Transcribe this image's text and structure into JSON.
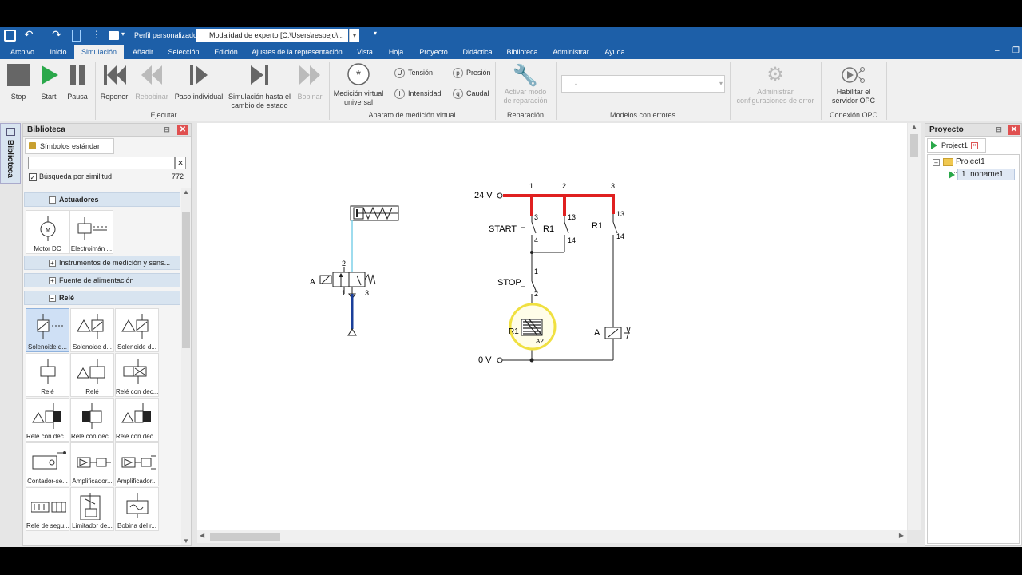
{
  "quick_access": {
    "profile_label": "Perfil personalizado",
    "mode_field": "Modalidad de experto [C:\\Users\\respejo\\..."
  },
  "menu_tabs": [
    "Archivo",
    "Inicio",
    "Simulación",
    "Añadir",
    "Selección",
    "Edición",
    "Ajustes de la representación",
    "Vista",
    "Hoja",
    "Proyecto",
    "Didáctica",
    "Biblioteca",
    "Administrar",
    "Ayuda"
  ],
  "active_tab": "Simulación",
  "ribbon": {
    "stop": "Stop",
    "start": "Start",
    "pause": "Pausa",
    "reset": "Reponer",
    "rewind": "Rebobinar",
    "single_step": "Paso individual",
    "sim_until_1": "Simulación hasta el",
    "sim_until_2": "cambio de estado",
    "rewind2": "Bobinar",
    "group_execute": "Ejecutar",
    "virtual_meas_1": "Medición virtual",
    "virtual_meas_2": "universal",
    "tension_sym": "U",
    "tension": "Tensión",
    "current_sym": "I",
    "current": "Intensidad",
    "pressure_sym": "p",
    "pressure": "Presión",
    "flow_sym": "q",
    "flow": "Caudal",
    "group_virtual": "Aparato de medición virtual",
    "repair_1": "Activar modo",
    "repair_2": "de reparación",
    "group_repair": "Reparación",
    "faults_select": "-",
    "group_faults": "Modelos con errores",
    "admin_1": "Administrar",
    "admin_2": "configuraciones de error",
    "opc_1": "Habilitar el",
    "opc_2": "servidor OPC",
    "group_opc": "Conexión OPC"
  },
  "library": {
    "title": "Biblioteca",
    "vertical_tab": "Biblioteca",
    "tab": "Símbolos estándar",
    "search_value": "",
    "similarity_label": "Búsqueda por similitud",
    "similarity_count": "772",
    "categories": {
      "actuators": "Actuadores",
      "instruments": "Instrumentos de medición y sens...",
      "power": "Fuente de alimentación",
      "relay": "Relé"
    },
    "actuator_tiles": [
      "Motor DC",
      "Electroimán ..."
    ],
    "relay_tiles": [
      "Solenoide d...",
      "Solenoide d...",
      "Solenoide d...",
      "Relé",
      "Relé",
      "Relé con dec...",
      "Relé con dec...",
      "Relé con dec...",
      "Relé con dec...",
      "Contador-se...",
      "Amplificador...",
      "Amplificador...",
      "Relé de segu...",
      "Limitador de...",
      "Bobina del r..."
    ]
  },
  "project": {
    "title": "Proyecto",
    "tab": "Project1",
    "root": "Project1",
    "item_num": "1",
    "item_name": "noname1"
  },
  "circuit": {
    "v24": "24 V",
    "v0": "0 V",
    "start": "START",
    "stop": "STOP",
    "r1": "R1",
    "a": "A",
    "a2": "A2",
    "n1": "1",
    "n2": "2",
    "n3": "3",
    "n4": "4",
    "n13": "13",
    "n14": "14"
  },
  "colors": {
    "accent": "#1d5fa8",
    "live_wire": "#e02020",
    "highlight": "#f0e040"
  }
}
